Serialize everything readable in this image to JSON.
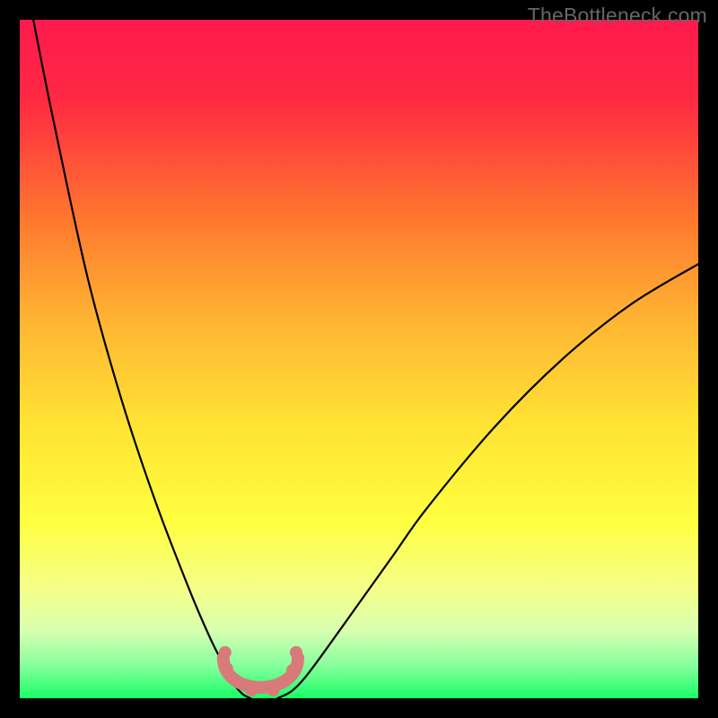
{
  "watermark": "TheBottleneck.com",
  "chart_data": {
    "type": "line",
    "title": "",
    "xlabel": "",
    "ylabel": "",
    "xlim": [
      0,
      100
    ],
    "ylim": [
      0,
      100
    ],
    "grid": false,
    "legend": false,
    "series": [
      {
        "name": "left-curve",
        "x": [
          2,
          5,
          10,
          15,
          20,
          25,
          28,
          30,
          31,
          32,
          33,
          34
        ],
        "values": [
          100,
          85,
          62,
          44,
          29,
          16,
          9,
          5,
          3,
          1.5,
          0.5,
          0
        ]
      },
      {
        "name": "right-curve",
        "x": [
          38,
          40,
          42,
          45,
          50,
          55,
          60,
          70,
          80,
          90,
          100
        ],
        "values": [
          0,
          1,
          3,
          7,
          14,
          21,
          28,
          40,
          50,
          58,
          64
        ]
      }
    ],
    "annotations": [
      {
        "name": "trough-marker",
        "x_range": [
          30,
          41
        ],
        "y": 2,
        "color": "#d97a7a"
      }
    ],
    "background_gradient": {
      "stops": [
        {
          "pos": 0.0,
          "color": "#ff1a4d"
        },
        {
          "pos": 0.12,
          "color": "#ff2a42"
        },
        {
          "pos": 0.3,
          "color": "#ff7a2e"
        },
        {
          "pos": 0.45,
          "color": "#ffb733"
        },
        {
          "pos": 0.6,
          "color": "#ffe433"
        },
        {
          "pos": 0.74,
          "color": "#ffff40"
        },
        {
          "pos": 0.84,
          "color": "#f5ff8a"
        },
        {
          "pos": 0.9,
          "color": "#d8ffb0"
        },
        {
          "pos": 0.95,
          "color": "#8aff9e"
        },
        {
          "pos": 1.0,
          "color": "#1aff66"
        }
      ]
    }
  }
}
